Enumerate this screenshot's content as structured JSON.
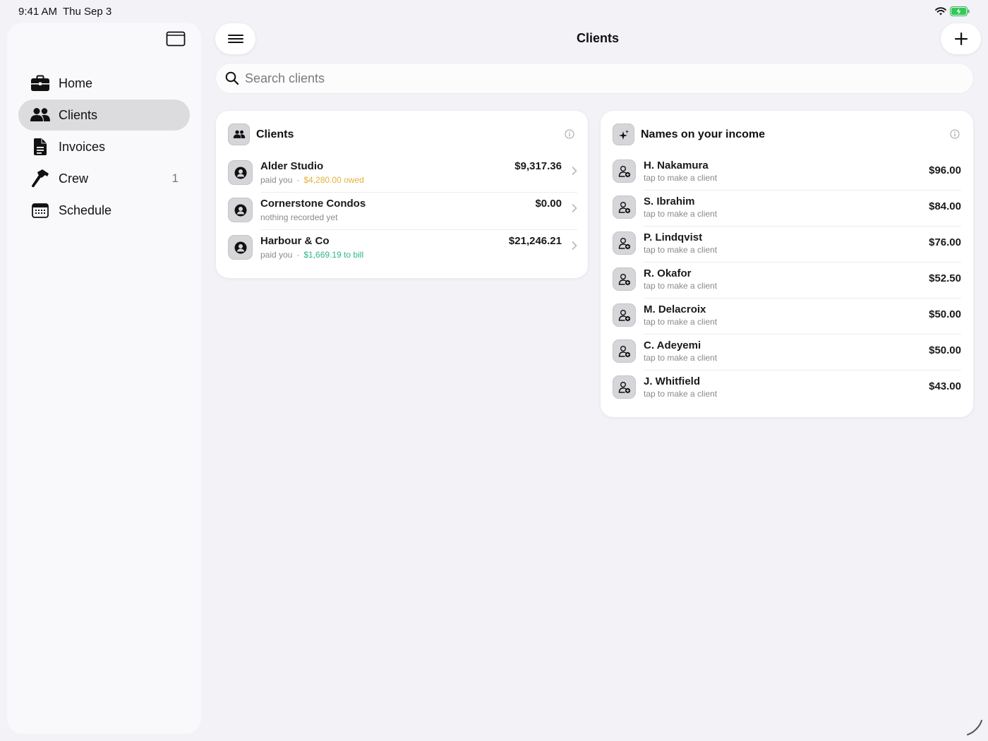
{
  "status_bar": {
    "time": "9:41 AM",
    "date": "Thu Sep 3"
  },
  "sidebar": {
    "items": [
      {
        "label": "Home",
        "icon": "briefcase-icon",
        "active": false,
        "badge": ""
      },
      {
        "label": "Clients",
        "icon": "people-icon",
        "active": true,
        "badge": ""
      },
      {
        "label": "Invoices",
        "icon": "document-icon",
        "active": false,
        "badge": ""
      },
      {
        "label": "Crew",
        "icon": "hammer-icon",
        "active": false,
        "badge": "1"
      },
      {
        "label": "Schedule",
        "icon": "calendar-icon",
        "active": false,
        "badge": ""
      }
    ]
  },
  "header": {
    "title": "Clients"
  },
  "search": {
    "placeholder": "Search clients",
    "value": ""
  },
  "clients_card": {
    "title": "Clients",
    "rows": [
      {
        "name": "Alder Studio",
        "sub": "paid you",
        "extra": "$4,280.00 owed",
        "extra_kind": "owed",
        "amount": "$9,317.36"
      },
      {
        "name": "Cornerstone Condos",
        "sub": "nothing recorded yet",
        "extra": "",
        "extra_kind": "",
        "amount": "$0.00"
      },
      {
        "name": "Harbour & Co",
        "sub": "paid you",
        "extra": "$1,669.19 to bill",
        "extra_kind": "bill",
        "amount": "$21,246.21"
      }
    ]
  },
  "names_card": {
    "title": "Names on your income",
    "rows": [
      {
        "name": "H. Nakamura",
        "sub": "tap to make a client",
        "amount": "$96.00"
      },
      {
        "name": "S. Ibrahim",
        "sub": "tap to make a client",
        "amount": "$84.00"
      },
      {
        "name": "P. Lindqvist",
        "sub": "tap to make a client",
        "amount": "$76.00"
      },
      {
        "name": "R. Okafor",
        "sub": "tap to make a client",
        "amount": "$52.50"
      },
      {
        "name": "M. Delacroix",
        "sub": "tap to make a client",
        "amount": "$50.00"
      },
      {
        "name": "C. Adeyemi",
        "sub": "tap to make a client",
        "amount": "$50.00"
      },
      {
        "name": "J. Whitfield",
        "sub": "tap to make a client",
        "amount": "$43.00"
      }
    ]
  },
  "colors": {
    "owed": "#e6b13a",
    "bill": "#2bb58a",
    "active_nav": "#dcdcdf",
    "background": "#f2f2f7"
  }
}
